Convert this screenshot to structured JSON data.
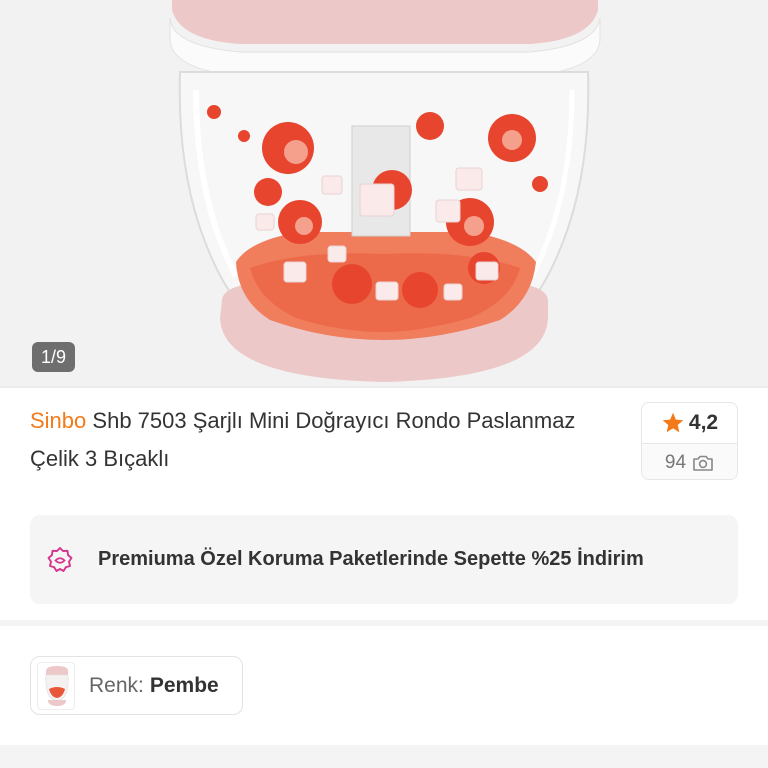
{
  "gallery": {
    "counter": "1/9",
    "image": "pink-chopper-product-photo"
  },
  "product": {
    "brand": "Sinbo",
    "name": "Shb 7503 Şarjlı Mini Doğrayıcı Rondo Paslanmaz Çelik 3 Bıçaklı"
  },
  "rating": {
    "score": "4,2",
    "count": "94",
    "star_icon": "star-icon",
    "camera_icon": "camera-icon"
  },
  "promo": {
    "icon": "premium-badge-icon",
    "text": "Premiuma Özel Koruma Paketlerinde Sepette %25 İndirim"
  },
  "variant": {
    "label": "Renk:",
    "value": "Pembe"
  },
  "colors": {
    "brand_orange": "#f27a1a",
    "star": "#f27a1a",
    "premium_pink": "#d6338d",
    "product_pink": "#ecc9c8"
  }
}
